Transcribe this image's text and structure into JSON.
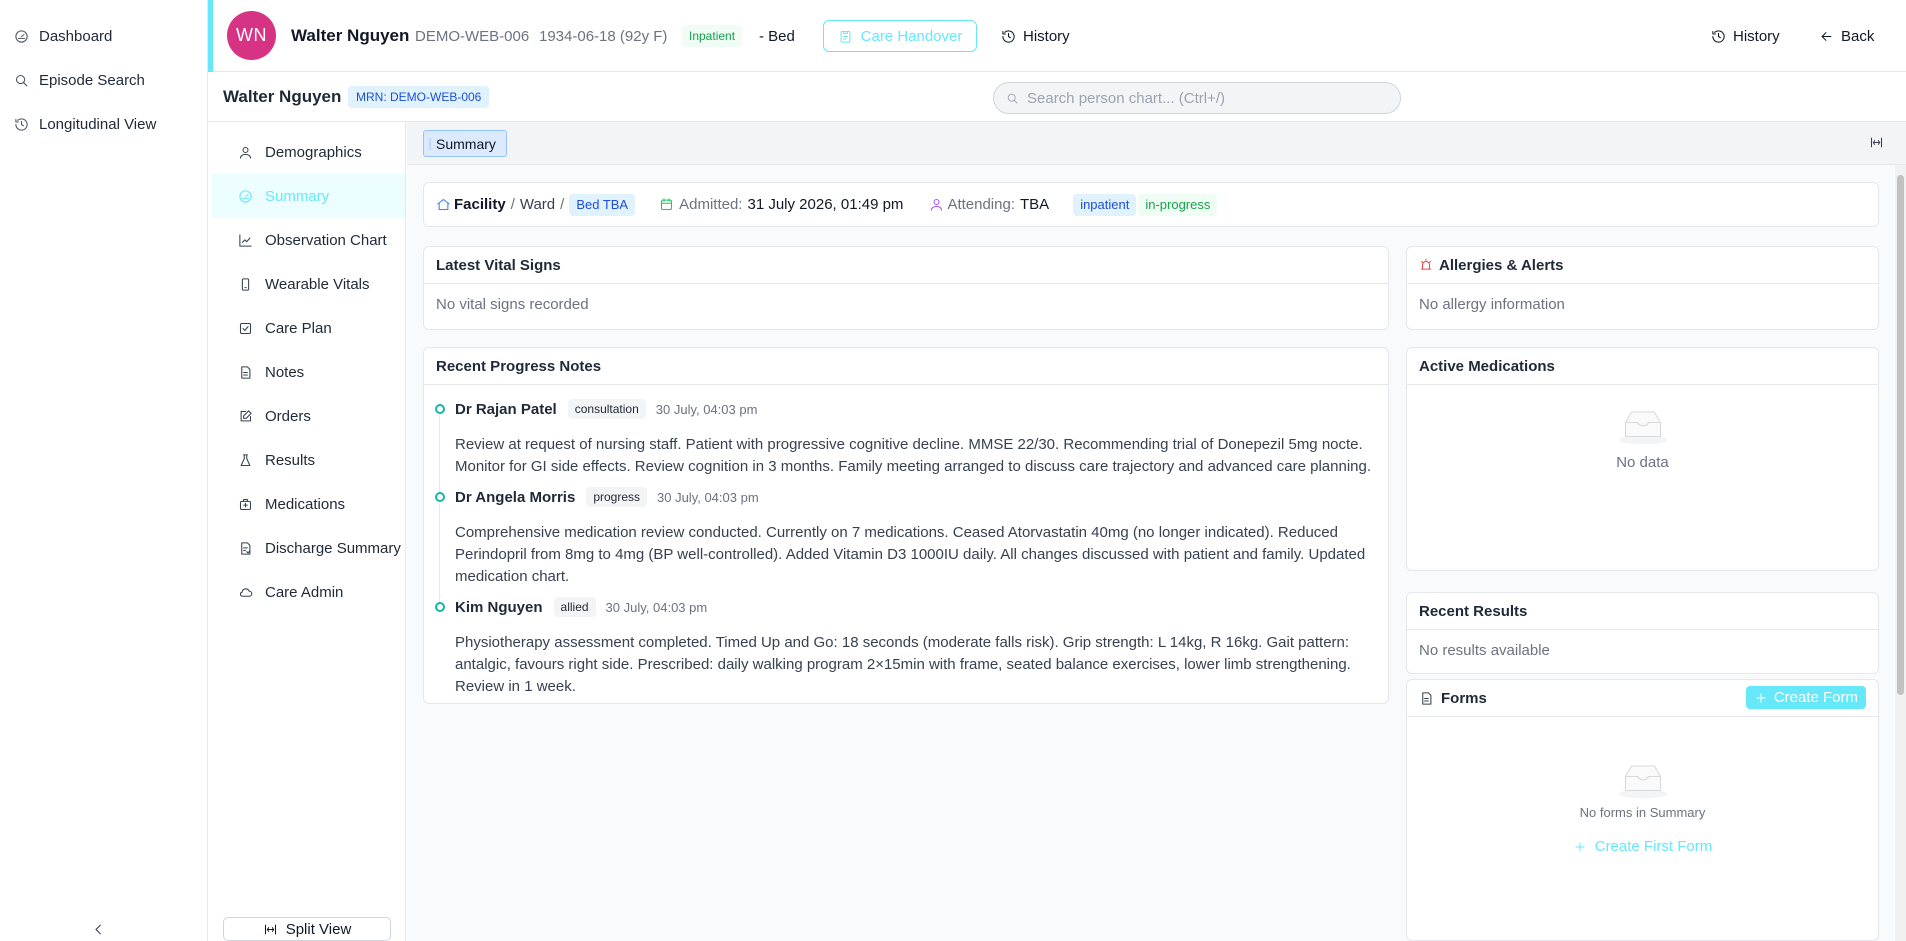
{
  "nav": {
    "items": [
      {
        "label": "Dashboard",
        "icon": "dashboard-icon"
      },
      {
        "label": "Episode Search",
        "icon": "search-icon"
      },
      {
        "label": "Longitudinal View",
        "icon": "history-icon"
      }
    ]
  },
  "header": {
    "initials": "WN",
    "name": "Walter Nguyen",
    "mrn": "DEMO-WEB-006",
    "dob": "1934-06-18 (92y F)",
    "status": "Inpatient",
    "bed": "- Bed",
    "handover_label": "Care Handover",
    "history_label": "History",
    "history_right_label": "History",
    "back_label": "Back"
  },
  "subheader": {
    "name": "Walter Nguyen",
    "mrn_badge": "MRN: DEMO-WEB-006",
    "search_placeholder": "Search person chart... (Ctrl+/)"
  },
  "chart_nav": {
    "items": [
      {
        "label": "Demographics",
        "icon": "user-icon",
        "active": false
      },
      {
        "label": "Summary",
        "icon": "dashboard-icon",
        "active": true
      },
      {
        "label": "Observation Chart",
        "icon": "chart-icon",
        "active": false
      },
      {
        "label": "Wearable Vitals",
        "icon": "watch-icon",
        "active": false
      },
      {
        "label": "Care Plan",
        "icon": "checkbox-icon",
        "active": false
      },
      {
        "label": "Notes",
        "icon": "document-icon",
        "active": false
      },
      {
        "label": "Orders",
        "icon": "edit-icon",
        "active": false
      },
      {
        "label": "Results",
        "icon": "flask-icon",
        "active": false
      },
      {
        "label": "Medications",
        "icon": "medkit-icon",
        "active": false
      },
      {
        "label": "Discharge Summary",
        "icon": "discharge-icon",
        "active": false
      },
      {
        "label": "Care Admin",
        "icon": "cloud-icon",
        "active": false
      }
    ],
    "split_view_label": "Split View"
  },
  "tabs": {
    "active": "Summary"
  },
  "encounter": {
    "facility": "Facility",
    "ward": "Ward",
    "bed": "Bed TBA",
    "admitted_label": "Admitted:",
    "admitted_value": "31 July 2026, 01:49 pm",
    "attending_label": "Attending:",
    "attending_value": "TBA",
    "class_tag": "inpatient",
    "status_tag": "in-progress"
  },
  "vitals": {
    "title": "Latest Vital Signs",
    "empty": "No vital signs recorded"
  },
  "allergies": {
    "title": "Allergies & Alerts",
    "empty": "No allergy information"
  },
  "notes": {
    "title": "Recent Progress Notes",
    "items": [
      {
        "author": "Dr Rajan Patel",
        "type": "consultation",
        "time": "30 July, 04:03 pm",
        "body": "Review at request of nursing staff. Patient with progressive cognitive decline. MMSE 22/30. Recommending trial of Donepezil 5mg nocte. Monitor for GI side effects. Review cognition in 3 months. Family meeting arranged to discuss care trajectory and advanced care planning."
      },
      {
        "author": "Dr Angela Morris",
        "type": "progress",
        "time": "30 July, 04:03 pm",
        "body": "Comprehensive medication review conducted. Currently on 7 medications. Ceased Atorvastatin 40mg (no longer indicated). Reduced Perindopril from 8mg to 4mg (BP well-controlled). Added Vitamin D3 1000IU daily. All changes discussed with patient and family. Updated medication chart."
      },
      {
        "author": "Kim Nguyen",
        "type": "allied",
        "time": "30 July, 04:03 pm",
        "body": "Physiotherapy assessment completed. Timed Up and Go: 18 seconds (moderate falls risk). Grip strength: L 14kg, R 16kg. Gait pattern: antalgic, favours right side. Prescribed: daily walking program 2×15min with frame, seated balance exercises, lower limb strengthening. Review in 1 week."
      }
    ]
  },
  "medications": {
    "title": "Active Medications",
    "empty": "No data"
  },
  "results": {
    "title": "Recent Results",
    "empty": "No results available"
  },
  "forms": {
    "title": "Forms",
    "create_label": "Create Form",
    "empty": "No forms in Summary",
    "create_first_label": "Create First Form"
  },
  "colors": {
    "accent": "#67e8f9",
    "avatar": "#d63384",
    "note_dot": "#14b8a6"
  }
}
